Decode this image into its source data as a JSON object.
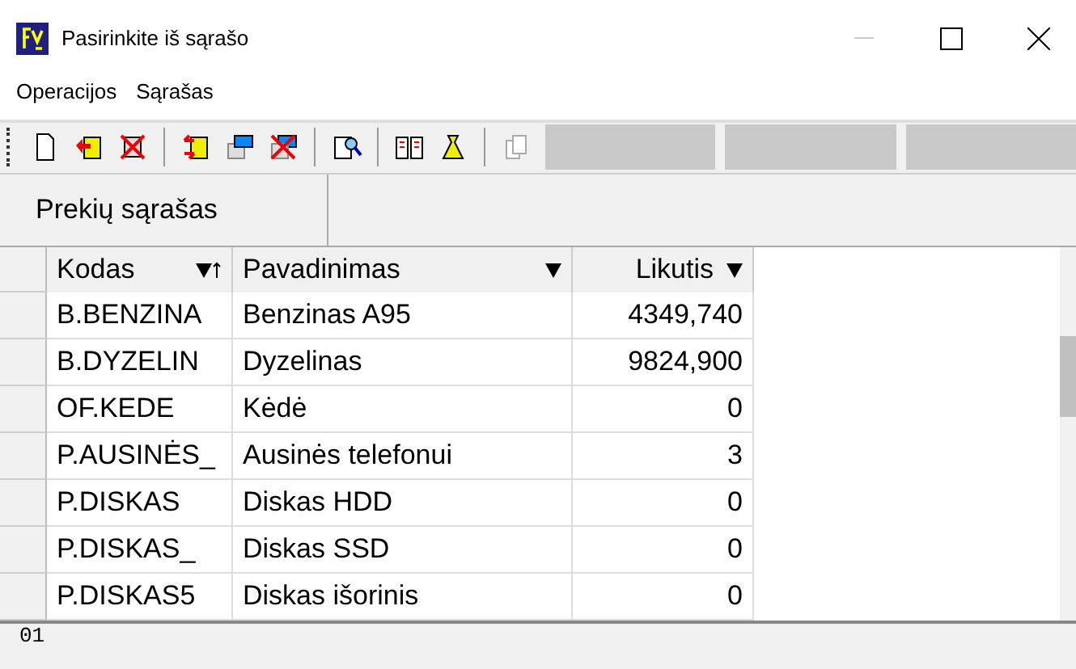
{
  "window": {
    "title": "Pasirinkite iš sąrašo"
  },
  "menu": [
    "Operacijos",
    "Sąrašas"
  ],
  "tab": {
    "label": "Prekių sąrašas",
    "selected": true
  },
  "table": {
    "columns": [
      {
        "label": "Kodas",
        "sorted": true
      },
      {
        "label": "Pavadinimas",
        "sorted": false
      },
      {
        "label": "Likutis",
        "sorted": false
      }
    ],
    "rows": [
      {
        "cells": [
          "B.BENZINA",
          "Benzinas A95",
          "4349,740"
        ]
      },
      {
        "cells": [
          "B.DYZELIN",
          "Dyzelinas",
          "9824,900"
        ]
      },
      {
        "cells": [
          "OF.KEDE",
          "Kėdė",
          "0"
        ]
      },
      {
        "cells": [
          "P.AUSINĖS_",
          "Ausinės telefonui",
          "3"
        ]
      },
      {
        "cells": [
          "P.DISKAS",
          "Diskas HDD",
          "0"
        ]
      },
      {
        "cells": [
          "P.DISKAS_",
          "Diskas SSD",
          "0"
        ]
      },
      {
        "cells": [
          "P.DISKAS5",
          "Diskas išorinis",
          "0"
        ]
      }
    ]
  },
  "status_bar": {
    "text": "01"
  }
}
